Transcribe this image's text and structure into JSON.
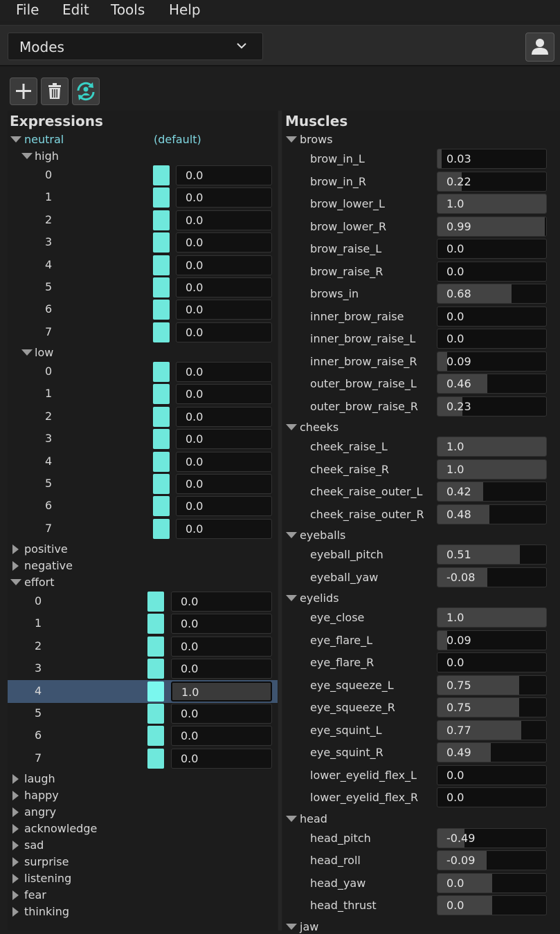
{
  "menu": [
    "File",
    "Edit",
    "Tools",
    "Help"
  ],
  "modes": {
    "label": "Modes"
  },
  "toolbar": {
    "add": "add-icon",
    "delete": "trash-icon",
    "sync": "sync-user-icon"
  },
  "expressions": {
    "title": "Expressions",
    "neutral": {
      "label": "neutral",
      "default_label": "(default)"
    },
    "high": {
      "label": "high",
      "values": [
        "0.0",
        "0.0",
        "0.0",
        "0.0",
        "0.0",
        "0.0",
        "0.0",
        "0.0"
      ],
      "indices": [
        "0",
        "1",
        "2",
        "3",
        "4",
        "5",
        "6",
        "7"
      ]
    },
    "low": {
      "label": "low",
      "values": [
        "0.0",
        "0.0",
        "0.0",
        "0.0",
        "0.0",
        "0.0",
        "0.0",
        "0.0"
      ],
      "indices": [
        "0",
        "1",
        "2",
        "3",
        "4",
        "5",
        "6",
        "7"
      ]
    },
    "positive": "positive",
    "negative": "negative",
    "effort": {
      "label": "effort",
      "values": [
        "0.0",
        "0.0",
        "0.0",
        "0.0",
        "1.0",
        "0.0",
        "0.0",
        "0.0"
      ],
      "indices": [
        "0",
        "1",
        "2",
        "3",
        "4",
        "5",
        "6",
        "7"
      ],
      "selected_index": 4
    },
    "collapsed": [
      "laugh",
      "happy",
      "angry",
      "acknowledge",
      "sad",
      "surprise",
      "listening",
      "fear",
      "thinking"
    ]
  },
  "muscles": {
    "title": "Muscles",
    "groups": [
      {
        "name": "brows",
        "items": [
          {
            "label": "brow_in_L",
            "value": "0.03",
            "level": 0.03
          },
          {
            "label": "brow_in_R",
            "value": "0.22",
            "level": 0.22
          },
          {
            "label": "brow_lower_L",
            "value": "1.0",
            "level": 1.0
          },
          {
            "label": "brow_lower_R",
            "value": "0.99",
            "level": 0.99
          },
          {
            "label": "brow_raise_L",
            "value": "0.0",
            "level": 0.0
          },
          {
            "label": "brow_raise_R",
            "value": "0.0",
            "level": 0.0
          },
          {
            "label": "brows_in",
            "value": "0.68",
            "level": 0.68
          },
          {
            "label": "inner_brow_raise",
            "value": "0.0",
            "level": 0.0
          },
          {
            "label": "inner_brow_raise_L",
            "value": "0.0",
            "level": 0.0
          },
          {
            "label": "inner_brow_raise_R",
            "value": "0.09",
            "level": 0.09
          },
          {
            "label": "outer_brow_raise_L",
            "value": "0.46",
            "level": 0.46
          },
          {
            "label": "outer_brow_raise_R",
            "value": "0.23",
            "level": 0.23
          }
        ]
      },
      {
        "name": "cheeks",
        "items": [
          {
            "label": "cheek_raise_L",
            "value": "1.0",
            "level": 1.0
          },
          {
            "label": "cheek_raise_R",
            "value": "1.0",
            "level": 1.0
          },
          {
            "label": "cheek_raise_outer_L",
            "value": "0.42",
            "level": 0.42
          },
          {
            "label": "cheek_raise_outer_R",
            "value": "0.48",
            "level": 0.48
          }
        ]
      },
      {
        "name": "eyeballs",
        "items": [
          {
            "label": "eyeball_pitch",
            "value": "0.51",
            "level": 0.76
          },
          {
            "label": "eyeball_yaw",
            "value": "-0.08",
            "level": 0.46
          }
        ]
      },
      {
        "name": "eyelids",
        "items": [
          {
            "label": "eye_close",
            "value": "1.0",
            "level": 1.0
          },
          {
            "label": "eye_flare_L",
            "value": "0.09",
            "level": 0.09
          },
          {
            "label": "eye_flare_R",
            "value": "0.0",
            "level": 0.0
          },
          {
            "label": "eye_squeeze_L",
            "value": "0.75",
            "level": 0.75
          },
          {
            "label": "eye_squeeze_R",
            "value": "0.75",
            "level": 0.75
          },
          {
            "label": "eye_squint_L",
            "value": "0.77",
            "level": 0.77
          },
          {
            "label": "eye_squint_R",
            "value": "0.49",
            "level": 0.49
          },
          {
            "label": "lower_eyelid_flex_L",
            "value": "0.0",
            "level": 0.0
          },
          {
            "label": "lower_eyelid_flex_R",
            "value": "0.0",
            "level": 0.0
          }
        ]
      },
      {
        "name": "head",
        "items": [
          {
            "label": "head_pitch",
            "value": "-0.49",
            "level": 0.25
          },
          {
            "label": "head_roll",
            "value": "-0.09",
            "level": 0.45
          },
          {
            "label": "head_yaw",
            "value": "0.0",
            "level": 0.5
          },
          {
            "label": "head_thrust",
            "value": "0.0",
            "level": 0.5
          }
        ]
      },
      {
        "name": "jaw",
        "items": []
      }
    ]
  },
  "colors": {
    "accent": "#6fe8dc",
    "selection": "#3e5470",
    "link": "#7fd6e0"
  }
}
